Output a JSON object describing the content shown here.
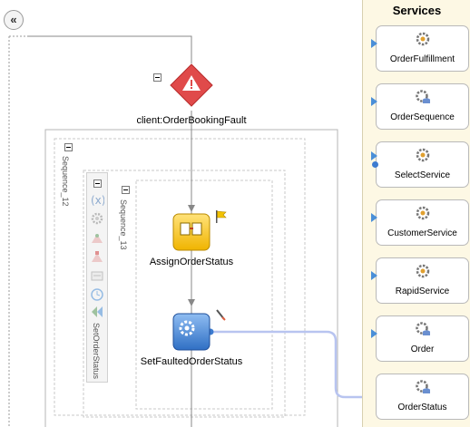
{
  "toolbar": {
    "collapse_glyph": "«"
  },
  "fault": {
    "label": "client:OrderBookingFault",
    "icon": "warning-icon",
    "color": "#e04a4a"
  },
  "scopes": {
    "outer": {
      "label": "Sequence_12"
    },
    "inner": {
      "label": "Sequence_13"
    },
    "scope_vertical_label": "SetOrderStatus"
  },
  "activities": [
    {
      "label": "AssignOrderStatus",
      "icon": "assign-icon",
      "color": "#f5c518"
    },
    {
      "label": "SetFaultedOrderStatus",
      "icon": "invoke-gear-icon",
      "color": "#3f7fd1"
    }
  ],
  "services_panel": {
    "title": "Services",
    "items": [
      {
        "label": "OrderFulfillment",
        "icon": "gear-service-icon"
      },
      {
        "label": "OrderSequence",
        "icon": "db-service-icon"
      },
      {
        "label": "SelectService",
        "icon": "gear-service-icon"
      },
      {
        "label": "CustomerService",
        "icon": "gear-service-icon"
      },
      {
        "label": "RapidService",
        "icon": "gear-service-icon"
      },
      {
        "label": "Order",
        "icon": "db-service-icon"
      },
      {
        "label": "OrderStatus",
        "icon": "db-service-icon"
      }
    ]
  },
  "colors": {
    "panel_bg": "#fdf8e4",
    "wire": "#b8c4f0",
    "accent_blue": "#4a8fd8"
  }
}
